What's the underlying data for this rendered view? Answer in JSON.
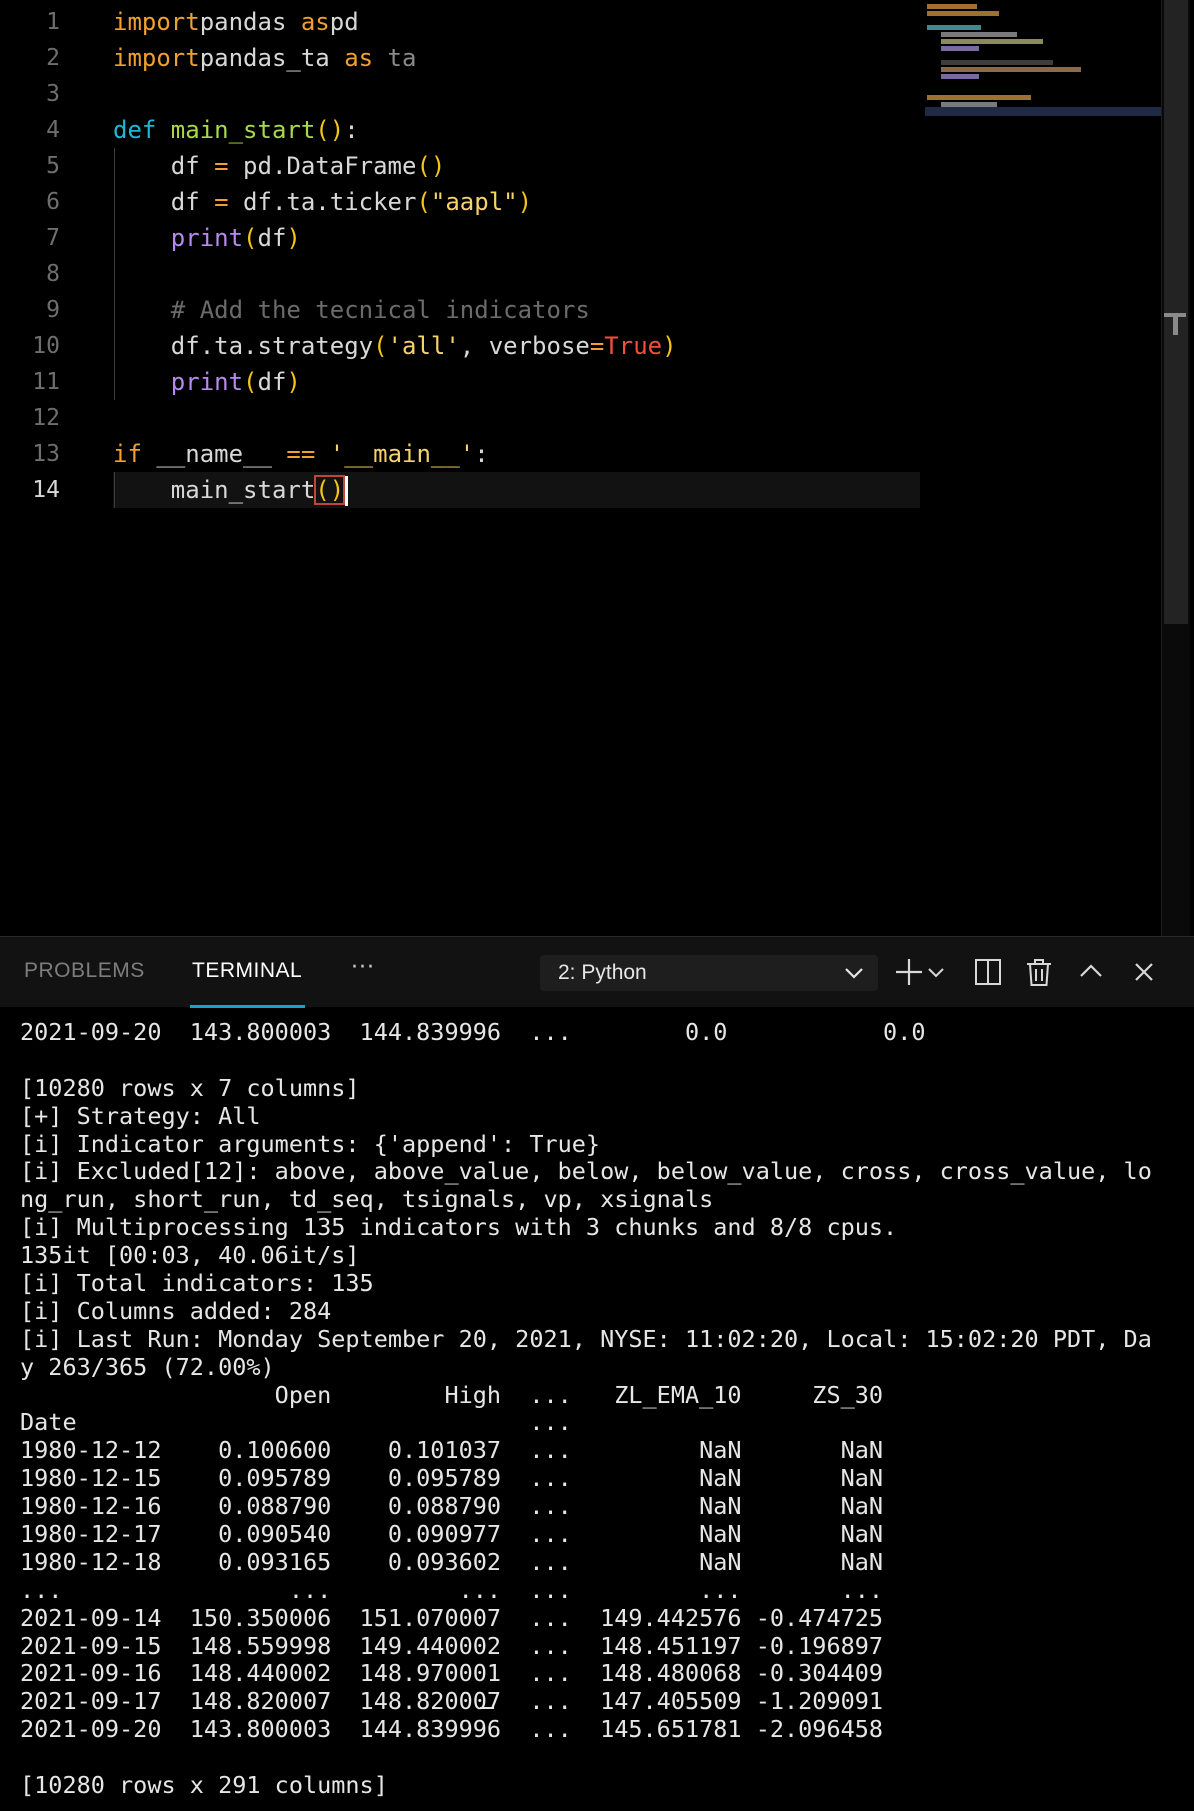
{
  "editor": {
    "lines": [
      {
        "n": "1",
        "code": [
          [
            "t-kw",
            "import"
          ],
          [
            "",
            "pandas "
          ],
          [
            "t-kw",
            "as"
          ],
          [
            "",
            "pd"
          ]
        ]
      },
      {
        "n": "2",
        "code": [
          [
            "t-kw",
            "import"
          ],
          [
            "",
            "pandas_ta "
          ],
          [
            "t-kw",
            "as"
          ],
          [
            "t-dim",
            " ta"
          ]
        ]
      },
      {
        "n": "3",
        "code": []
      },
      {
        "n": "4",
        "code": [
          [
            "t-def",
            "def "
          ],
          [
            "t-fn",
            "main_start"
          ],
          [
            "t-paren",
            "()"
          ],
          [
            "",
            ":"
          ]
        ]
      },
      {
        "n": "5",
        "code": [
          [
            "",
            "    df "
          ],
          [
            "t-op",
            "="
          ],
          [
            "",
            " pd.DataFrame"
          ],
          [
            "t-paren",
            "()"
          ]
        ]
      },
      {
        "n": "6",
        "code": [
          [
            "",
            "    df "
          ],
          [
            "t-op",
            "="
          ],
          [
            "",
            " df.ta.ticker"
          ],
          [
            "t-paren",
            "("
          ],
          [
            "t-str",
            "\"aapl\""
          ],
          [
            "t-paren",
            ")"
          ]
        ]
      },
      {
        "n": "7",
        "code": [
          [
            "t-bi",
            "    print"
          ],
          [
            "t-paren",
            "("
          ],
          [
            "",
            "df"
          ],
          [
            "t-paren",
            ")"
          ]
        ]
      },
      {
        "n": "8",
        "code": []
      },
      {
        "n": "9",
        "code": [
          [
            "t-com",
            "    # Add the tecnical indicators"
          ]
        ]
      },
      {
        "n": "10",
        "code": [
          [
            "",
            "    df.ta.strategy"
          ],
          [
            "t-paren",
            "("
          ],
          [
            "t-str",
            "'all'"
          ],
          [
            "",
            ", verbose"
          ],
          [
            "t-op",
            "="
          ],
          [
            "t-true",
            "True"
          ],
          [
            "t-paren",
            ")"
          ]
        ]
      },
      {
        "n": "11",
        "code": [
          [
            "t-bi",
            "    print"
          ],
          [
            "t-paren",
            "("
          ],
          [
            "",
            "df"
          ],
          [
            "t-paren",
            ")"
          ]
        ]
      },
      {
        "n": "12",
        "code": []
      },
      {
        "n": "13",
        "code": [
          [
            "t-kw",
            "if"
          ],
          [
            "",
            " __name__ "
          ],
          [
            "t-op",
            "=="
          ],
          [
            "",
            " "
          ],
          [
            "t-str",
            "'__main__'"
          ],
          [
            "",
            ":"
          ]
        ]
      },
      {
        "n": "14",
        "code": [
          [
            "",
            "    main_start"
          ]
        ]
      }
    ],
    "active_line": "14"
  },
  "panel": {
    "tabs": {
      "problems": "PROBLEMS",
      "terminal": "TERMINAL",
      "more": "···"
    },
    "terminal_select": "2: Python",
    "icons": {
      "new": "plus-icon",
      "split": "split-icon",
      "kill": "trash-icon",
      "maximize": "chevron-up-icon",
      "close": "close-icon"
    }
  },
  "terminal_lines": [
    "2021-09-20  143.800003  144.839996  ...        0.0           0.0",
    "",
    "[10280 rows x 7 columns]",
    "[+] Strategy: All",
    "[i] Indicator arguments: {'append': True}",
    "[i] Excluded[12]: above, above_value, below, below_value, cross, cross_value, lo",
    "ng_run, short_run, td_seq, tsignals, vp, xsignals",
    "[i] Multiprocessing 135 indicators with 3 chunks and 8/8 cpus.",
    "135it [00:03, 40.06it/s]",
    "[i] Total indicators: 135",
    "[i] Columns added: 284",
    "[i] Last Run: Monday September 20, 2021, NYSE: 11:02:20, Local: 15:02:20 PDT, Da",
    "y 263/365 (72.00%)",
    "                  Open        High  ...   ZL_EMA_10     ZS_30",
    "Date                                ...                      ",
    "1980-12-12    0.100600    0.101037  ...         NaN       NaN",
    "1980-12-15    0.095789    0.095789  ...         NaN       NaN",
    "1980-12-16    0.088790    0.088790  ...         NaN       NaN",
    "1980-12-17    0.090540    0.090977  ...         NaN       NaN",
    "1980-12-18    0.093165    0.093602  ...         NaN       NaN",
    "...                ...         ...  ...         ...       ...",
    "2021-09-14  150.350006  151.070007  ...  149.442576 -0.474725",
    "2021-09-15  148.559998  149.440002  ...  148.451197 -0.196897",
    "2021-09-16  148.440002  148.970001  ...  148.480068 -0.304409",
    "2021-09-17  148.820007  148.820007  ...  147.405509 -1.209091",
    "2021-09-20  143.800003  144.839996  ...  145.651781 -2.096458",
    "",
    "[10280 rows x 291 columns]"
  ]
}
